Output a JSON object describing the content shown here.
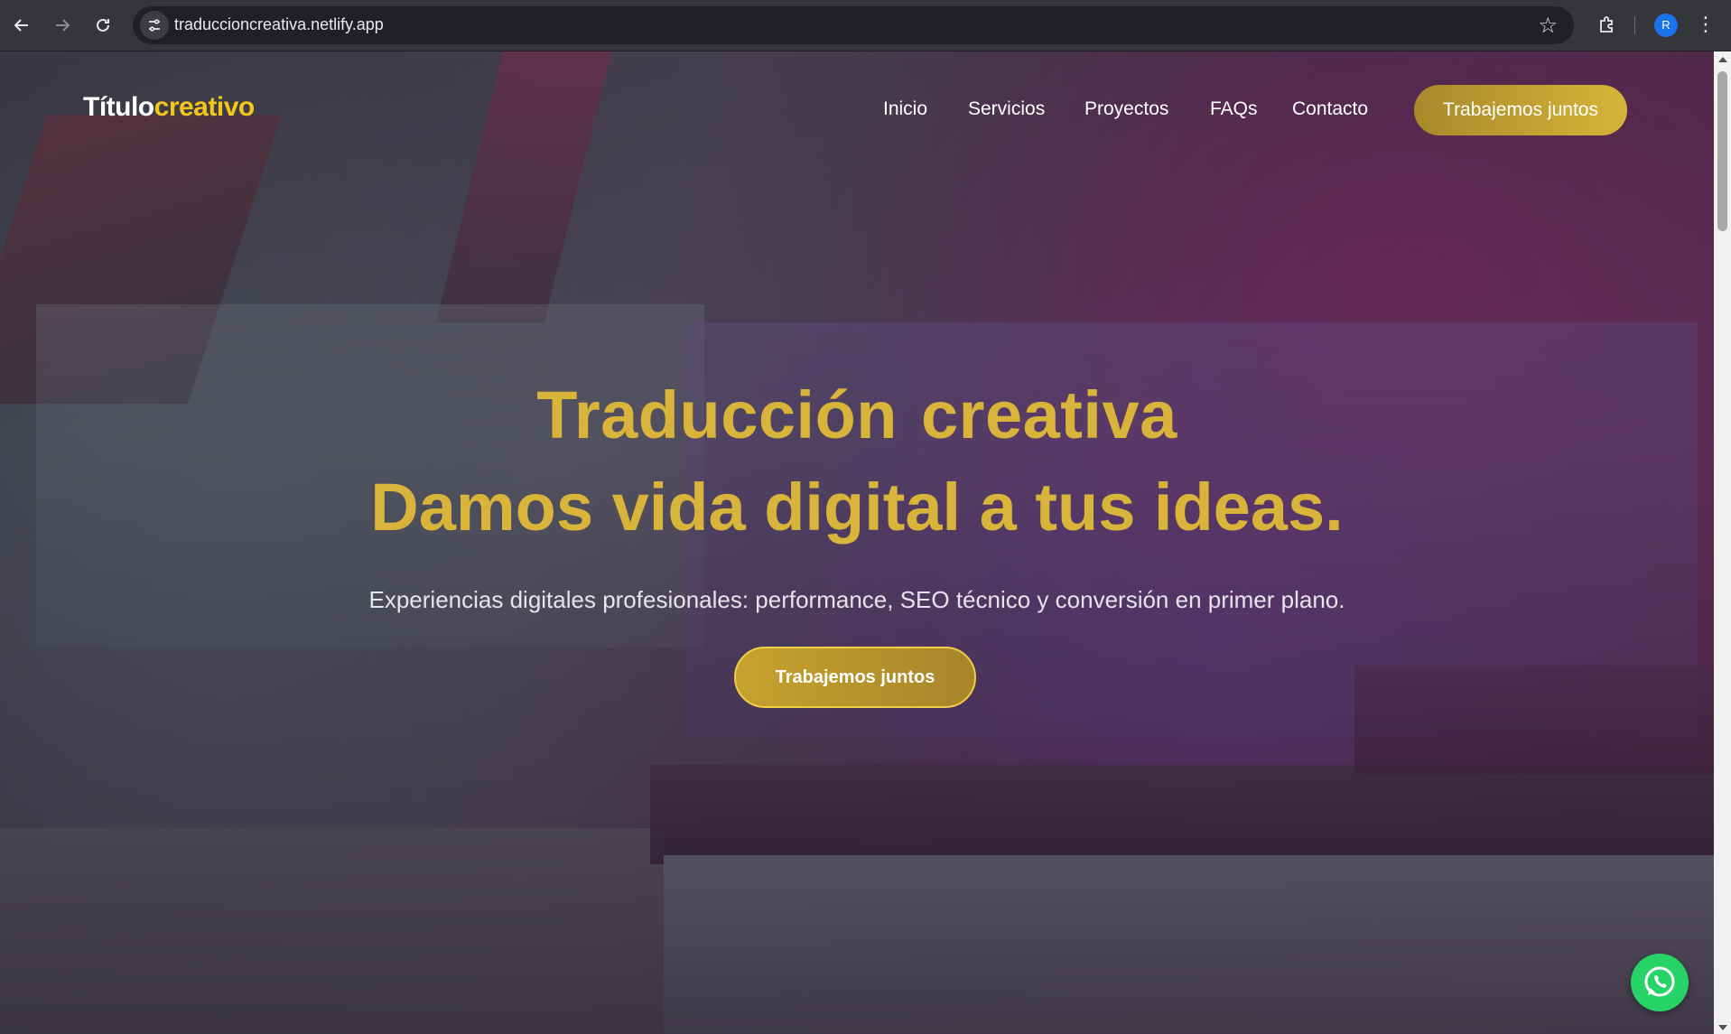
{
  "browser": {
    "back_icon": "arrow-left-icon",
    "forward_icon": "arrow-right-icon",
    "reload_icon": "reload-icon",
    "url": "traduccioncreativa.netlify.app",
    "profile_initial": "R"
  },
  "header": {
    "logo_part1": "Título",
    "logo_part2": "creativo",
    "nav": [
      "Inicio",
      "Servicios",
      "Proyectos",
      "FAQs",
      "Contacto"
    ],
    "cta_label": "Trabajemos juntos"
  },
  "hero": {
    "title_word1": "Traducción",
    "title_word2": "creativa",
    "subtitle_line": "Damos vida digital a tus ideas.",
    "description": "Experiencias digitales profesionales: performance, SEO técnico y conversión en primer plano.",
    "cta_label": "Trabajemos juntos"
  },
  "colors": {
    "accent_gold": "#d9b43a",
    "logo_yellow": "#f5c518",
    "whatsapp_green": "#25d366"
  },
  "floating": {
    "whatsapp_icon": "whatsapp-icon"
  }
}
